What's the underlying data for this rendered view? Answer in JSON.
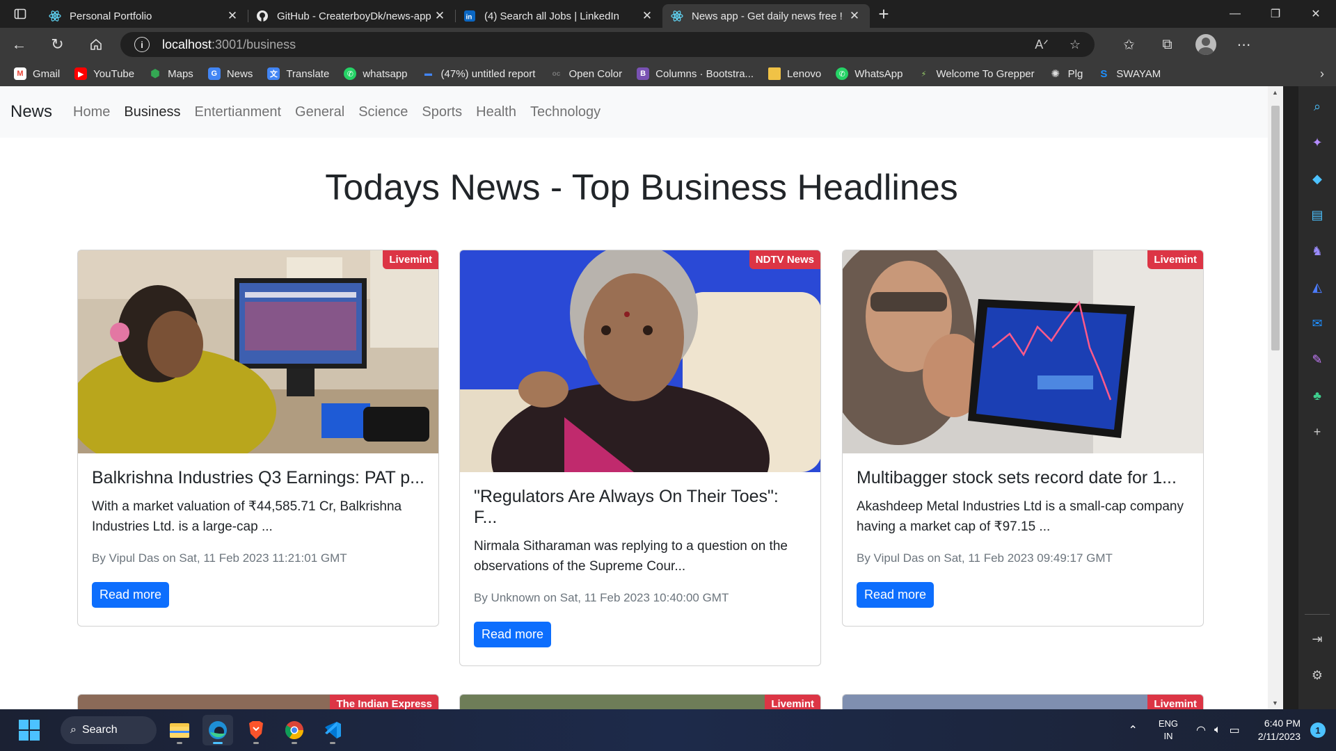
{
  "browser": {
    "tabs": [
      {
        "title": "Personal Portfolio",
        "active": false,
        "favicon": "react-icon"
      },
      {
        "title": "GitHub - CreaterboyDk/news-app",
        "active": false,
        "favicon": "github-icon"
      },
      {
        "title": "(4) Search all Jobs | LinkedIn",
        "active": false,
        "favicon": "linkedin-icon"
      },
      {
        "title": "News app - Get daily news free !",
        "active": true,
        "favicon": "react-icon"
      }
    ],
    "address": {
      "host": "localhost",
      "path": ":3001/business"
    },
    "bookmarks": [
      {
        "label": "Gmail",
        "icon": "gmail-icon",
        "color": "#ea4335"
      },
      {
        "label": "YouTube",
        "icon": "youtube-icon",
        "color": "#ff0000"
      },
      {
        "label": "Maps",
        "icon": "maps-icon",
        "color": "#34a853"
      },
      {
        "label": "News",
        "icon": "google-news-icon",
        "color": "#4285f4"
      },
      {
        "label": "Translate",
        "icon": "translate-icon",
        "color": "#4285f4"
      },
      {
        "label": "whatsapp",
        "icon": "whatsapp-icon",
        "color": "#25d366"
      },
      {
        "label": "(47%) untitled report",
        "icon": "report-icon",
        "color": "#3a3a3a"
      },
      {
        "label": "Open Color",
        "icon": "open-color-icon",
        "color": "#3a3a3a"
      },
      {
        "label": "Columns · Bootstra...",
        "icon": "bootstrap-icon",
        "color": "#7952b3"
      },
      {
        "label": "Lenovo",
        "icon": "folder-icon",
        "color": "#f0c246"
      },
      {
        "label": "WhatsApp",
        "icon": "whatsapp-icon",
        "color": "#25d366"
      },
      {
        "label": "Welcome To Grepper",
        "icon": "grepper-icon",
        "color": "#3a3a3a"
      },
      {
        "label": "Plg",
        "icon": "openai-icon",
        "color": "#3a3a3a"
      },
      {
        "label": "SWAYAM",
        "icon": "swayam-icon",
        "color": "#3a3a3a"
      }
    ]
  },
  "navbar": {
    "brand": "News",
    "links": [
      {
        "label": "Home",
        "active": false
      },
      {
        "label": "Business",
        "active": true
      },
      {
        "label": "Entertianment",
        "active": false
      },
      {
        "label": "General",
        "active": false
      },
      {
        "label": "Science",
        "active": false
      },
      {
        "label": "Sports",
        "active": false
      },
      {
        "label": "Health",
        "active": false
      },
      {
        "label": "Technology",
        "active": false
      }
    ]
  },
  "page": {
    "title": "Todays News - Top Business Headlines"
  },
  "articles": [
    {
      "source": "Livemint",
      "title": "Balkrishna Industries Q3 Earnings: PAT p...",
      "description": "With a market valuation of ₹44,585.71 Cr, Balkrishna Industries Ltd. is a large-cap ...",
      "meta": "By Vipul Das on Sat, 11 Feb 2023 11:21:01 GMT",
      "button": "Read more"
    },
    {
      "source": "NDTV News",
      "title": "\"Regulators Are Always On Their Toes\": F...",
      "description": "Nirmala Sitharaman was replying to a question on the observations of the Supreme Cour...",
      "meta": "By Unknown on Sat, 11 Feb 2023 10:40:00 GMT",
      "button": "Read more"
    },
    {
      "source": "Livemint",
      "title": "Multibagger stock sets record date for 1...",
      "description": "Akashdeep Metal Industries Ltd is a small-cap company having a market cap of ₹97.15 ...",
      "meta": "By Vipul Das on Sat, 11 Feb 2023 09:49:17 GMT",
      "button": "Read more"
    },
    {
      "source": "The Indian Express"
    },
    {
      "source": "Livemint"
    },
    {
      "source": "Livemint"
    }
  ],
  "taskbar": {
    "search_label": "Search",
    "language": "ENG",
    "region": "IN",
    "time": "6:40 PM",
    "date": "2/11/2023",
    "notification_count": "1"
  }
}
